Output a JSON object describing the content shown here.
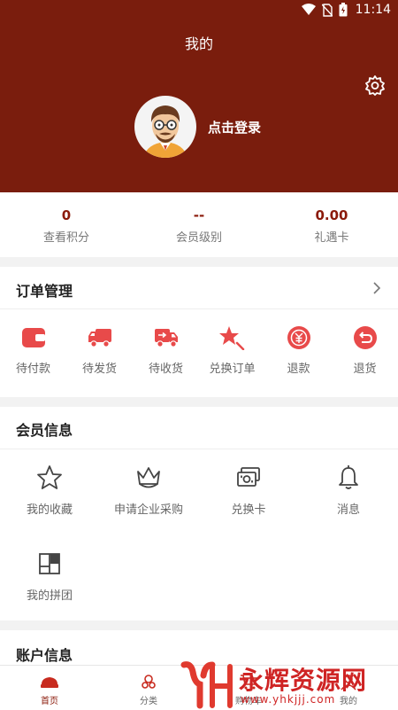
{
  "status_bar": {
    "time": "11:14"
  },
  "header": {
    "title": "我的",
    "login_text": "点击登录"
  },
  "icons": {
    "settings": "settings-gear-icon",
    "avatar": "user-avatar-cartoon"
  },
  "colors": {
    "brand": "#7a1d0d",
    "accent": "#8b1a0a",
    "icon_red": "#e84a4a"
  },
  "stats": [
    {
      "value": "0",
      "label": "查看积分"
    },
    {
      "value": "--",
      "label": "会员级别"
    },
    {
      "value": "0.00",
      "label": "礼遇卡"
    }
  ],
  "orders": {
    "title": "订单管理",
    "items": [
      {
        "label": "待付款",
        "icon": "wallet-icon"
      },
      {
        "label": "待发货",
        "icon": "truck-icon"
      },
      {
        "label": "待收货",
        "icon": "delivery-truck-icon"
      },
      {
        "label": "兑换订单",
        "icon": "exchange-star-icon"
      },
      {
        "label": "退款",
        "icon": "refund-icon"
      },
      {
        "label": "退货",
        "icon": "return-icon"
      }
    ]
  },
  "member": {
    "title": "会员信息",
    "items": [
      {
        "label": "我的收藏",
        "icon": "star-icon"
      },
      {
        "label": "申请企业采购",
        "icon": "crown-icon"
      },
      {
        "label": "兑换卡",
        "icon": "card-icon"
      },
      {
        "label": "消息",
        "icon": "bell-icon"
      },
      {
        "label": "我的拼团",
        "icon": "group-icon"
      }
    ]
  },
  "account": {
    "title": "账户信息"
  },
  "tabbar": [
    {
      "label": "首页",
      "icon": "home-icon"
    },
    {
      "label": "分类",
      "icon": "category-icon"
    },
    {
      "label": "购物车",
      "icon": "cart-icon"
    },
    {
      "label": "我的",
      "icon": "profile-icon"
    }
  ],
  "watermark": {
    "title": "永辉资源网",
    "url": "www.yhkjjj.com"
  }
}
